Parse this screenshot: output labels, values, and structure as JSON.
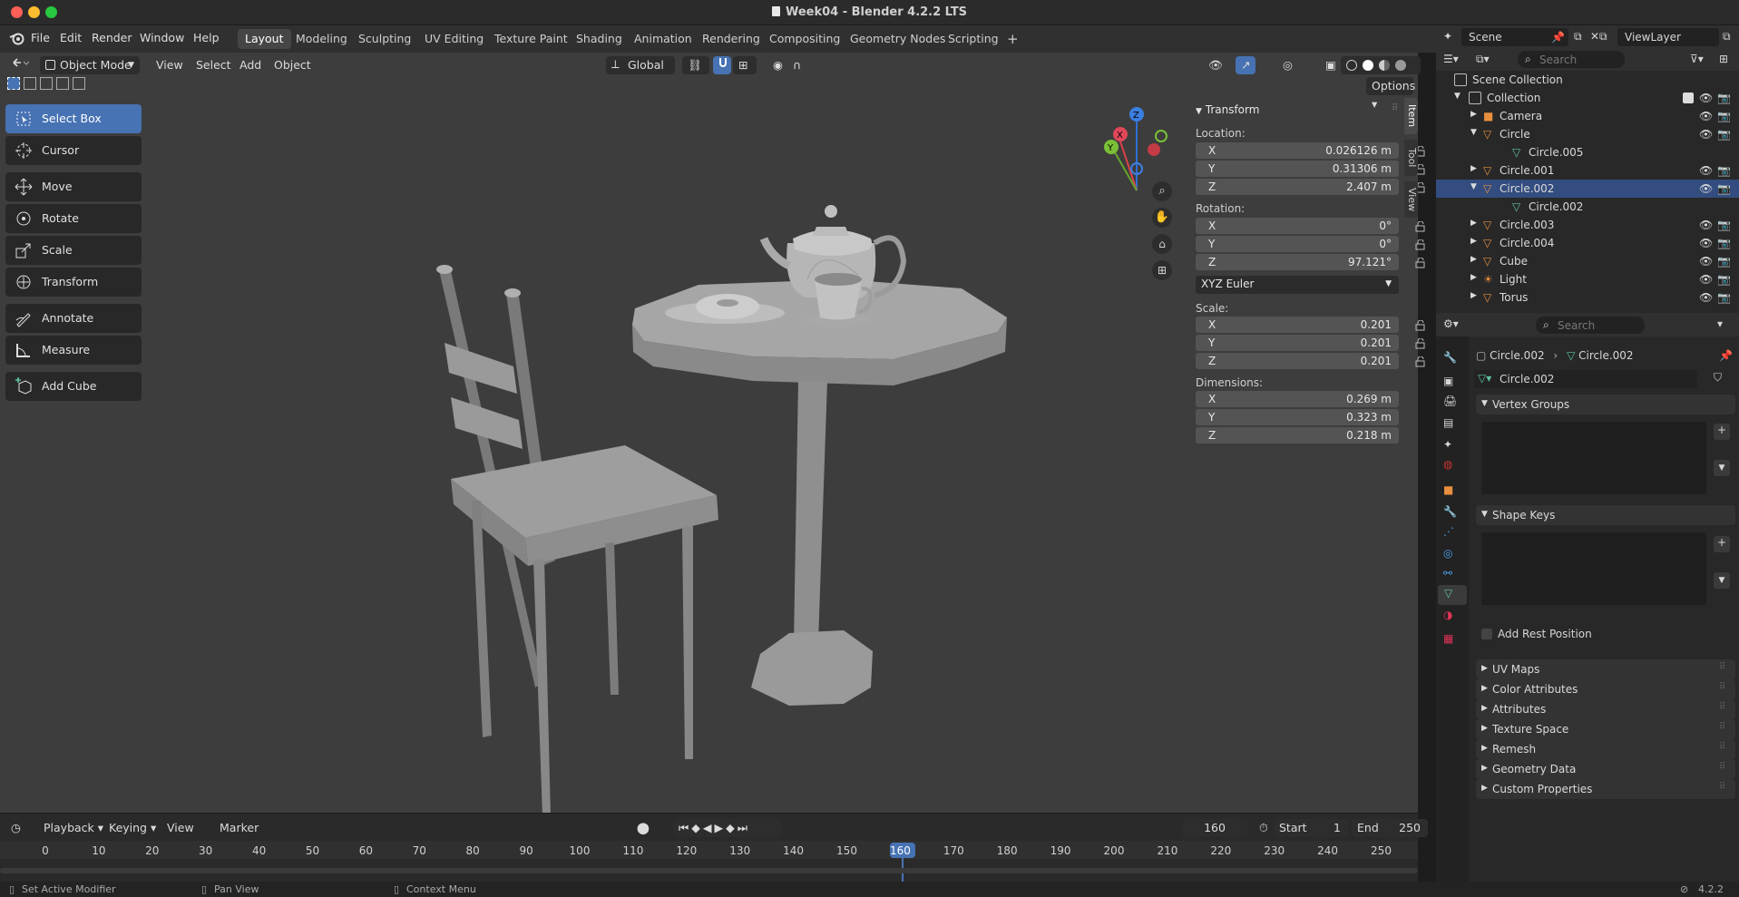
{
  "window": {
    "title": "Week04 - Blender 4.2.2 LTS"
  },
  "menus": [
    "File",
    "Edit",
    "Render",
    "Window",
    "Help"
  ],
  "workspaces": [
    "Layout",
    "Modeling",
    "Sculpting",
    "UV Editing",
    "Texture Paint",
    "Shading",
    "Animation",
    "Rendering",
    "Compositing",
    "Geometry Nodes",
    "Scripting"
  ],
  "active_workspace": "Layout",
  "viewport_header": {
    "mode": "Object Mode",
    "menus": [
      "View",
      "Select",
      "Add",
      "Object"
    ],
    "orientation": "Global",
    "options_label": "Options"
  },
  "toolbar": {
    "tools": [
      "Select Box",
      "Cursor",
      "Move",
      "Rotate",
      "Scale",
      "Transform",
      "Annotate",
      "Measure",
      "Add Cube"
    ],
    "active": "Select Box"
  },
  "gizmo": {
    "x": "X",
    "y": "Y",
    "z": "Z"
  },
  "transform_panel": {
    "title": "Transform",
    "location_label": "Location:",
    "location": [
      {
        "axis": "X",
        "value": "0.026126 m"
      },
      {
        "axis": "Y",
        "value": "0.31306 m"
      },
      {
        "axis": "Z",
        "value": "2.407 m"
      }
    ],
    "rotation_label": "Rotation:",
    "rotation": [
      {
        "axis": "X",
        "value": "0°"
      },
      {
        "axis": "Y",
        "value": "0°"
      },
      {
        "axis": "Z",
        "value": "97.121°"
      }
    ],
    "rotation_mode": "XYZ Euler",
    "scale_label": "Scale:",
    "scale": [
      {
        "axis": "X",
        "value": "0.201"
      },
      {
        "axis": "Y",
        "value": "0.201"
      },
      {
        "axis": "Z",
        "value": "0.201"
      }
    ],
    "dimensions_label": "Dimensions:",
    "dimensions": [
      {
        "axis": "X",
        "value": "0.269 m"
      },
      {
        "axis": "Y",
        "value": "0.323 m"
      },
      {
        "axis": "Z",
        "value": "0.218 m"
      }
    ]
  },
  "sidebar_tabs": [
    "Item",
    "Tool",
    "View"
  ],
  "timeline": {
    "menus": [
      "Playback",
      "Keying",
      "View",
      "Marker"
    ],
    "current_frame": "160",
    "start_label": "Start",
    "start": "1",
    "end_label": "End",
    "end": "250",
    "ticks": [
      "0",
      "10",
      "20",
      "30",
      "40",
      "50",
      "60",
      "70",
      "80",
      "90",
      "100",
      "110",
      "120",
      "130",
      "140",
      "150",
      "160",
      "170",
      "180",
      "190",
      "200",
      "210",
      "220",
      "230",
      "240",
      "250"
    ]
  },
  "statusbar": {
    "items": [
      "Set Active Modifier",
      "Pan View",
      "Context Menu"
    ],
    "version": "4.2.2"
  },
  "outliner": {
    "scene": "Scene",
    "view_layer": "ViewLayer",
    "search_placeholder": "Search",
    "root": "Scene Collection",
    "collection": "Collection",
    "items": [
      {
        "name": "Camera",
        "type": "camera",
        "indent": 0
      },
      {
        "name": "Circle",
        "type": "mesh",
        "indent": 0,
        "expanded": true
      },
      {
        "name": "Circle.005",
        "type": "meshdata",
        "indent": 1
      },
      {
        "name": "Circle.001",
        "type": "mesh",
        "indent": 0
      },
      {
        "name": "Circle.002",
        "type": "mesh",
        "indent": 0,
        "expanded": true,
        "selected": true
      },
      {
        "name": "Circle.002",
        "type": "meshdata",
        "indent": 1
      },
      {
        "name": "Circle.003",
        "type": "mesh",
        "indent": 0
      },
      {
        "name": "Circle.004",
        "type": "mesh",
        "indent": 0
      },
      {
        "name": "Cube",
        "type": "mesh",
        "indent": 0
      },
      {
        "name": "Light",
        "type": "light",
        "indent": 0
      },
      {
        "name": "Torus",
        "type": "mesh",
        "indent": 0
      }
    ]
  },
  "properties": {
    "search_placeholder": "Search",
    "breadcrumb": [
      "Circle.002",
      "Circle.002"
    ],
    "data_name": "Circle.002",
    "panels": {
      "vertex_groups": "Vertex Groups",
      "shape_keys": "Shape Keys",
      "add_rest_position": "Add Rest Position",
      "collapsed": [
        "UV Maps",
        "Color Attributes",
        "Attributes",
        "Texture Space",
        "Remesh",
        "Geometry Data",
        "Custom Properties"
      ]
    }
  },
  "colors": {
    "accent": "#4772b3",
    "mesh": "#e88f3f",
    "meshdata": "#5ec4a0",
    "viewport": "#3d3d3d"
  }
}
